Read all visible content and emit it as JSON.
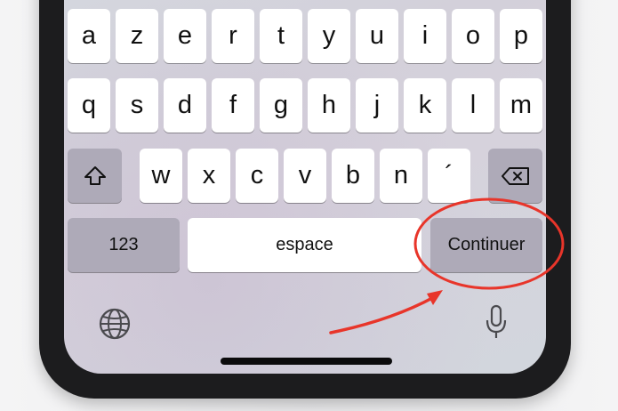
{
  "keyboard": {
    "row1": [
      "a",
      "z",
      "e",
      "r",
      "t",
      "y",
      "u",
      "i",
      "o",
      "p"
    ],
    "row2": [
      "q",
      "s",
      "d",
      "f",
      "g",
      "h",
      "j",
      "k",
      "l",
      "m"
    ],
    "row3": [
      "w",
      "x",
      "c",
      "v",
      "b",
      "n",
      "´"
    ],
    "numbers_label": "123",
    "space_label": "espace",
    "return_label": "Continuer",
    "shift_icon": "shift-icon",
    "backspace_icon": "backspace-icon",
    "globe_icon": "globe-icon",
    "mic_icon": "microphone-icon"
  },
  "annotation": {
    "circle_color": "#e8352a",
    "arrow_color": "#e8352a"
  }
}
